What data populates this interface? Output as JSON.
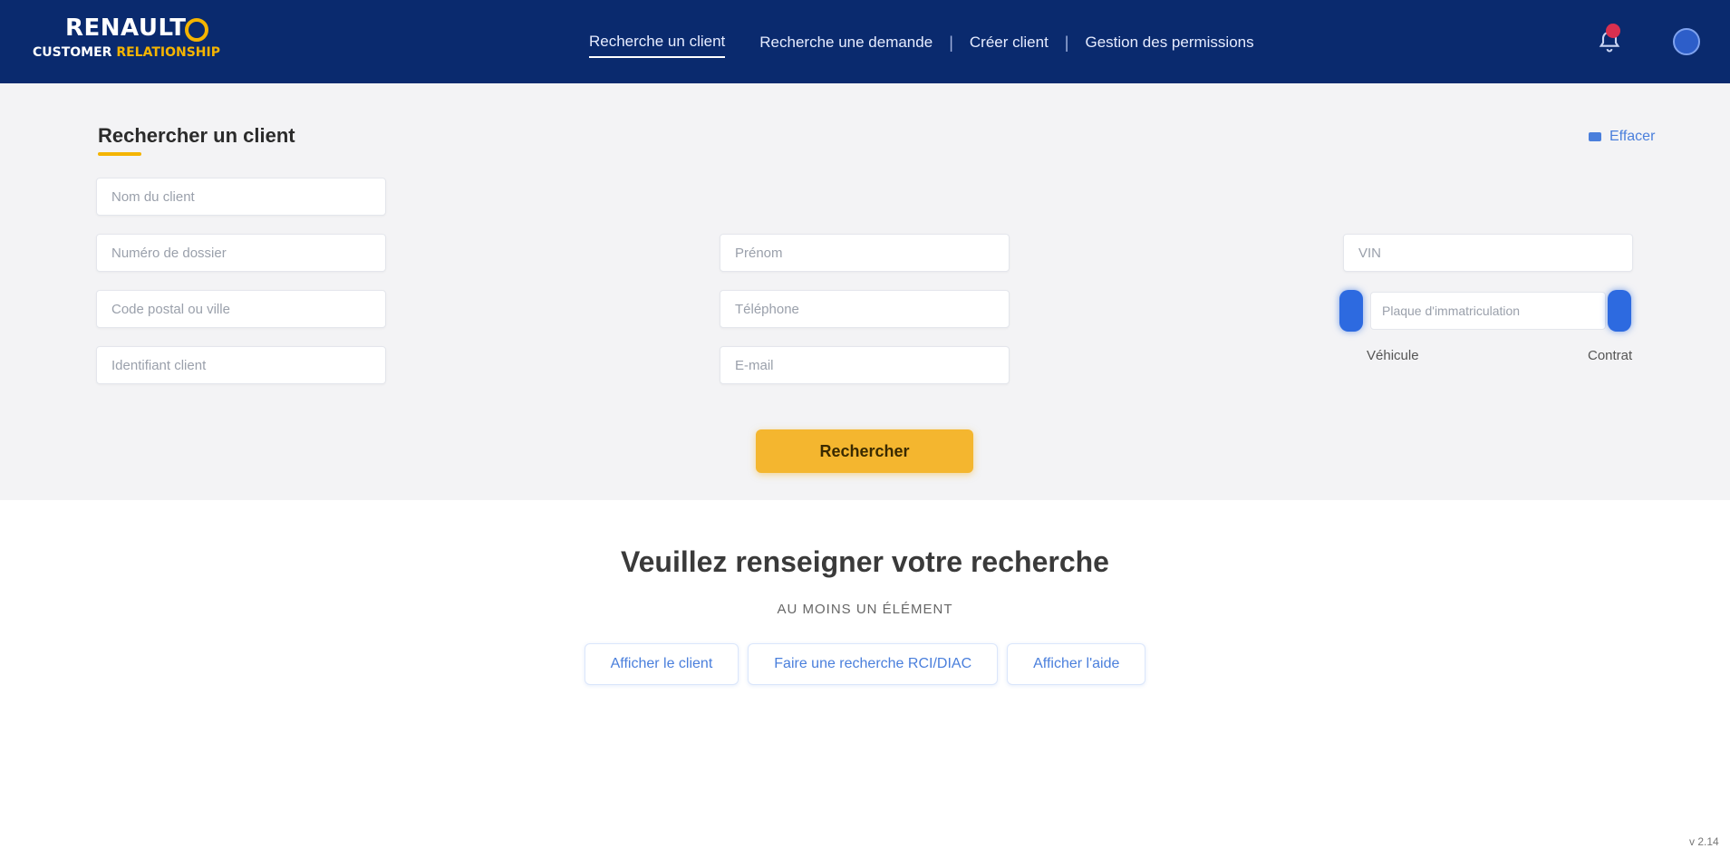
{
  "header": {
    "logo_top": "RENAULT",
    "logo_bottom_main": "CUSTOMER",
    "logo_bottom_accent": "RELATIONSHIP",
    "nav": [
      {
        "label": "Recherche un client"
      },
      {
        "label": "Recherche une demande"
      },
      {
        "label": "Créer client"
      },
      {
        "label": "Gestion des permissions"
      }
    ],
    "notification_icon": "bell-icon",
    "user_icon": "user-icon"
  },
  "search": {
    "title": "Rechercher un client",
    "reset_label": "Effacer",
    "fields": {
      "last_name": "Nom du client",
      "dossier_number": "Numéro de dossier",
      "postal_code_city": "Code postal ou ville",
      "client_id": "Identifiant client",
      "first_name": "Prénom",
      "phone": "Téléphone",
      "email": "E-mail",
      "vin": "VIN",
      "plate": "Plaque d'immatriculation"
    },
    "range_left_label": "Véhicule",
    "range_right_label": "Contrat",
    "submit_label": "Rechercher"
  },
  "empty_state": {
    "title": "Veuillez renseigner votre recherche",
    "subtitle": "AU MOINS UN ÉLÉMENT",
    "chips": [
      {
        "label": "Afficher le client"
      },
      {
        "label": "Faire une recherche RCI/DIAC"
      },
      {
        "label": "Afficher l'aide"
      }
    ]
  },
  "footer": {
    "version": "v 2.14"
  },
  "colors": {
    "header_bg": "#0a2a6e",
    "accent_yellow": "#f4b62f",
    "link_blue": "#4a7fdc",
    "notification_red": "#d9304f"
  }
}
